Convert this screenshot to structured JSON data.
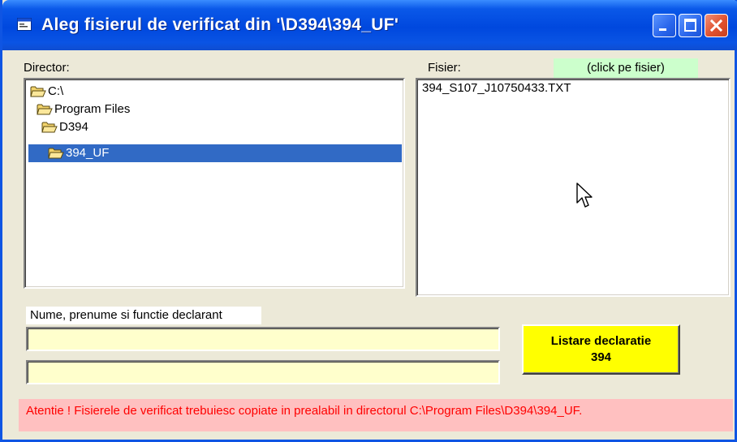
{
  "window": {
    "title": "Aleg fisierul de verificat din '\\D394\\394_UF'",
    "controls": [
      "minimize-icon",
      "maximize-icon",
      "close-icon"
    ]
  },
  "director": {
    "label": "Director:",
    "items": [
      {
        "label": "C:\\",
        "icon": "folder-open-icon",
        "selected": false
      },
      {
        "label": "Program Files",
        "icon": "folder-open-icon",
        "selected": false
      },
      {
        "label": "D394",
        "icon": "folder-open-icon",
        "selected": false
      },
      {
        "label": "394_UF",
        "icon": "folder-open-icon",
        "selected": true
      }
    ]
  },
  "fisier": {
    "label": "Fisier:",
    "hint": "(click pe fisier)",
    "items": [
      "394_S107_J10750433.TXT"
    ]
  },
  "declarant": {
    "label": "Nume, prenume si functie declarant",
    "field1_value": "",
    "field2_value": ""
  },
  "listare_button": {
    "line1": "Listare declaratie",
    "line2": "394"
  },
  "warning_text": "Atentie ! Fisierele de verificat trebuiesc copiate in prealabil in directorul C:\\Program Files\\D394\\394_UF.",
  "colors": {
    "titlebar": "#0a54e4",
    "selection": "#316ac5",
    "hint_bg": "#ccffcc",
    "input_bg": "#ffffcc",
    "button_bg": "#ffff00",
    "warning_bg": "#ffc0c0",
    "warning_text": "#ff0000"
  }
}
